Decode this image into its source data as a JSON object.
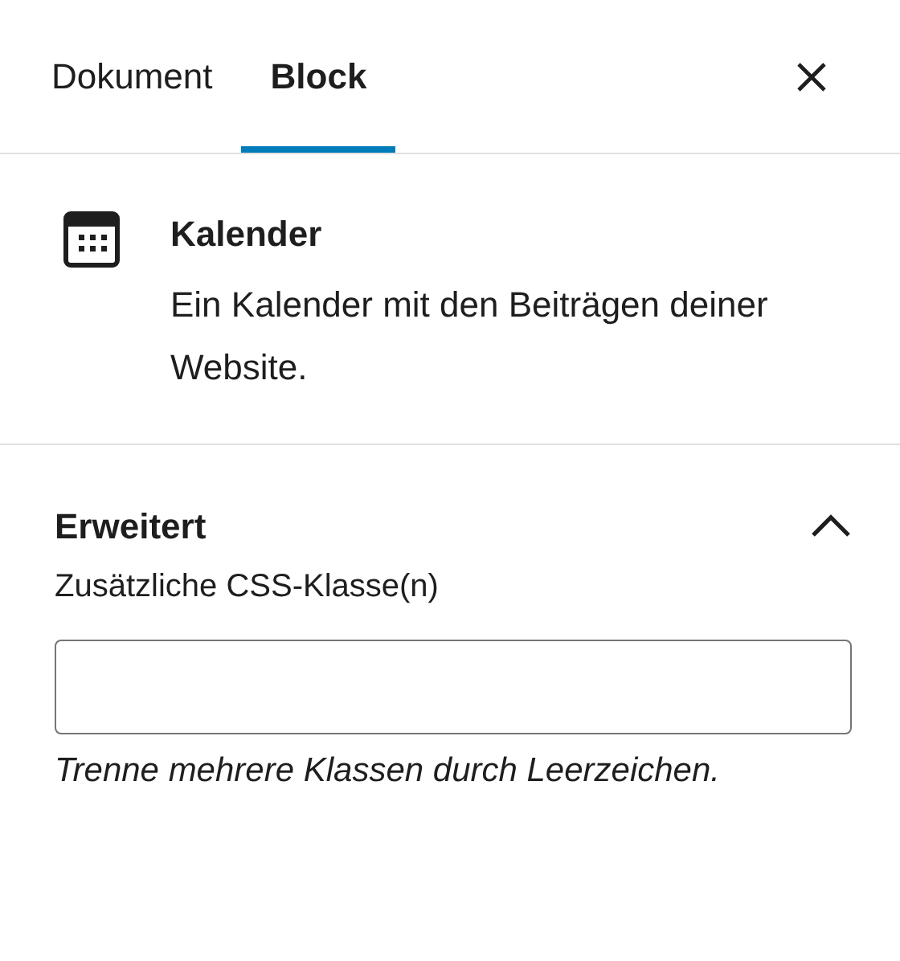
{
  "tabs": [
    {
      "label": "Dokument",
      "selected": false
    },
    {
      "label": "Block",
      "selected": true
    }
  ],
  "block": {
    "title": "Kalender",
    "description": "Ein Kalender mit den Beiträgen deiner Website."
  },
  "panel": {
    "title": "Erweitert",
    "expanded": true,
    "field": {
      "label": "Zusätzliche CSS-Klasse(n)",
      "help": "Trenne mehrere Klassen durch Leerzeichen."
    }
  }
}
